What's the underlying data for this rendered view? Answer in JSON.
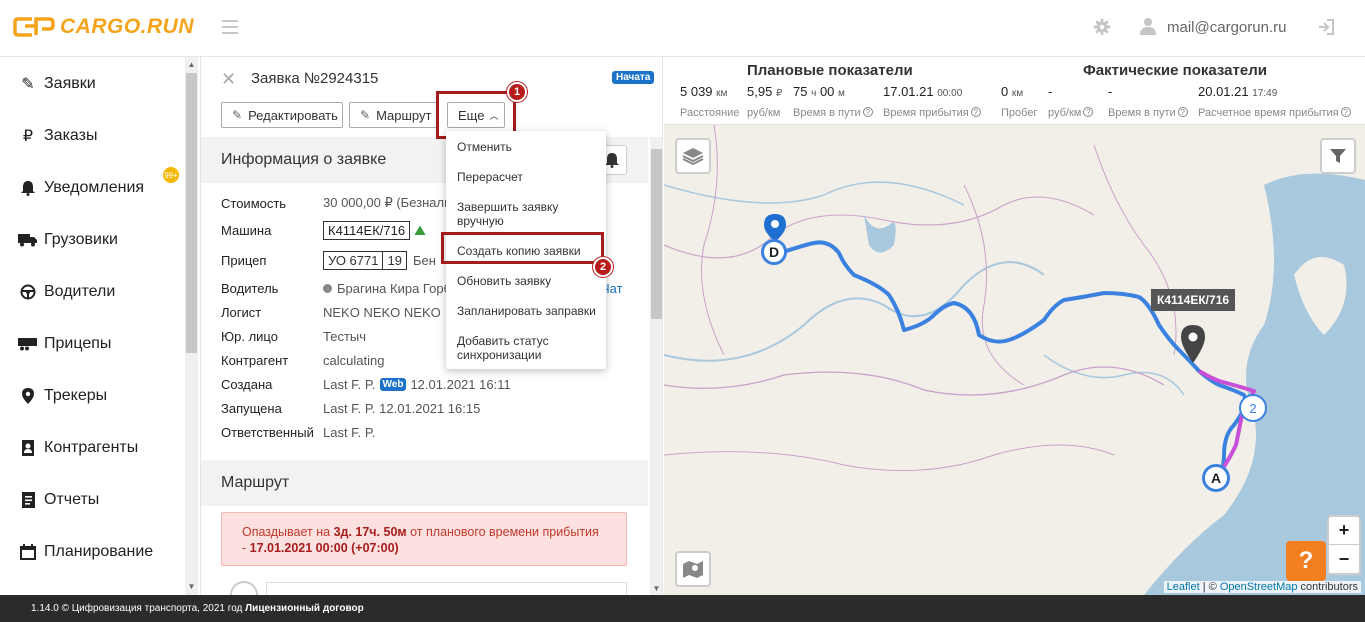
{
  "header": {
    "logo_text": "CARGO.RUN",
    "user_email": "mail@cargorun.ru"
  },
  "sidebar": {
    "items": [
      {
        "label": "Заявки",
        "icon": "edit-icon"
      },
      {
        "label": "Заказы",
        "icon": "ruble-icon"
      },
      {
        "label": "Уведомления",
        "icon": "bell-icon"
      },
      {
        "label": "Грузовики",
        "icon": "truck-icon"
      },
      {
        "label": "Водители",
        "icon": "steering-wheel-icon"
      },
      {
        "label": "Прицепы",
        "icon": "trailer-icon"
      },
      {
        "label": "Трекеры",
        "icon": "map-pin-icon"
      },
      {
        "label": "Контрагенты",
        "icon": "contacts-icon"
      },
      {
        "label": "Отчеты",
        "icon": "report-icon"
      },
      {
        "label": "Планирование",
        "icon": "calendar-icon"
      }
    ],
    "notifications_badge": "99+"
  },
  "request": {
    "title": "Заявка №2924315",
    "status": "Начата",
    "edit_label": "Редактировать",
    "route_label": "Маршрут",
    "more_label": "Еще"
  },
  "markers": {
    "one": "1",
    "two": "2"
  },
  "dropdown": {
    "items": [
      "Отменить",
      "Перерасчет",
      "Завершить заявку вручную",
      "Создать копию заявки",
      "Обновить заявку",
      "Запланировать заправки",
      "Добавить статус синхронизации"
    ]
  },
  "info": {
    "section_title": "Информация о заявке",
    "rows": {
      "cost": {
        "k": "Стоимость",
        "v": "30 000,00 ₽ (Безналич"
      },
      "car": {
        "k": "Машина",
        "plate": "К4114ЕК/716"
      },
      "trailer": {
        "k": "Прицеп",
        "plate": "УО 6771",
        "region": "19",
        "extra": "Бен"
      },
      "driver": {
        "k": "Водитель",
        "v": "Брагина Кира Горб",
        "link": "Чат"
      },
      "logist": {
        "k": "Логист",
        "v": "NEKO NEKO NEKO"
      },
      "legal": {
        "k": "Юр. лицо",
        "v": "Тестыч"
      },
      "counterparty": {
        "k": "Контрагент",
        "v": "calculating"
      },
      "created": {
        "k": "Создана",
        "who": "Last F. P.",
        "tag": "Web",
        "when": "12.01.2021 16:11"
      },
      "started": {
        "k": "Запущена",
        "v": "Last F. P. 12.01.2021 16:15"
      },
      "responsible": {
        "k": "Ответственный",
        "v": "Last F. P."
      }
    }
  },
  "route": {
    "section_title": "Маршрут",
    "alert_prefix": "Опаздывает на ",
    "alert_delay": "3д. 17ч. 50м",
    "alert_mid": " от планового времени прибытия - ",
    "alert_date": "17.01.2021 00:00 (+07:00)"
  },
  "stats": {
    "planned_title": "Плановые показатели",
    "actual_title": "Фактические показатели",
    "planned": {
      "distance": "5 039",
      "distance_unit": "км",
      "distance_label": "Расстояние",
      "rate": "5,95",
      "rate_unit": "₽",
      "rate_label": "руб/км",
      "travel": "75",
      "travel_h": "ч",
      "travel_m": "00",
      "travel_m_unit": "м",
      "travel_label": "Время в пути",
      "arrival": "17.01.21",
      "arrival_time": "00:00",
      "arrival_label": "Время прибытия"
    },
    "actual": {
      "mileage": "0",
      "mileage_unit": "км",
      "mileage_label": "Пробег",
      "rate": "-",
      "rate_label": "руб/км",
      "travel": "-",
      "travel_label": "Время в пути",
      "arrival": "20.01.21",
      "arrival_time": "17:49",
      "arrival_label": "Расчетное время прибытия"
    }
  },
  "map": {
    "truck_label": "К4114ЕК/716",
    "point_d": "D",
    "point_a": "A",
    "point_2": "2",
    "zoom_in": "+",
    "zoom_out": "−",
    "help": "?",
    "attrib_leaflet": "Leaflet",
    "attrib_sep": " | © ",
    "attrib_osm": "OpenStreetMap",
    "attrib_tail": " contributors",
    "colors": {
      "route_plan": "#3b82e0",
      "route_actual": "#c84fd8",
      "water": "#a8c8de"
    }
  },
  "footer": {
    "text": "1.14.0 © Цифровизация транспорта, 2021 год ",
    "license": "Лицензионный договор"
  }
}
